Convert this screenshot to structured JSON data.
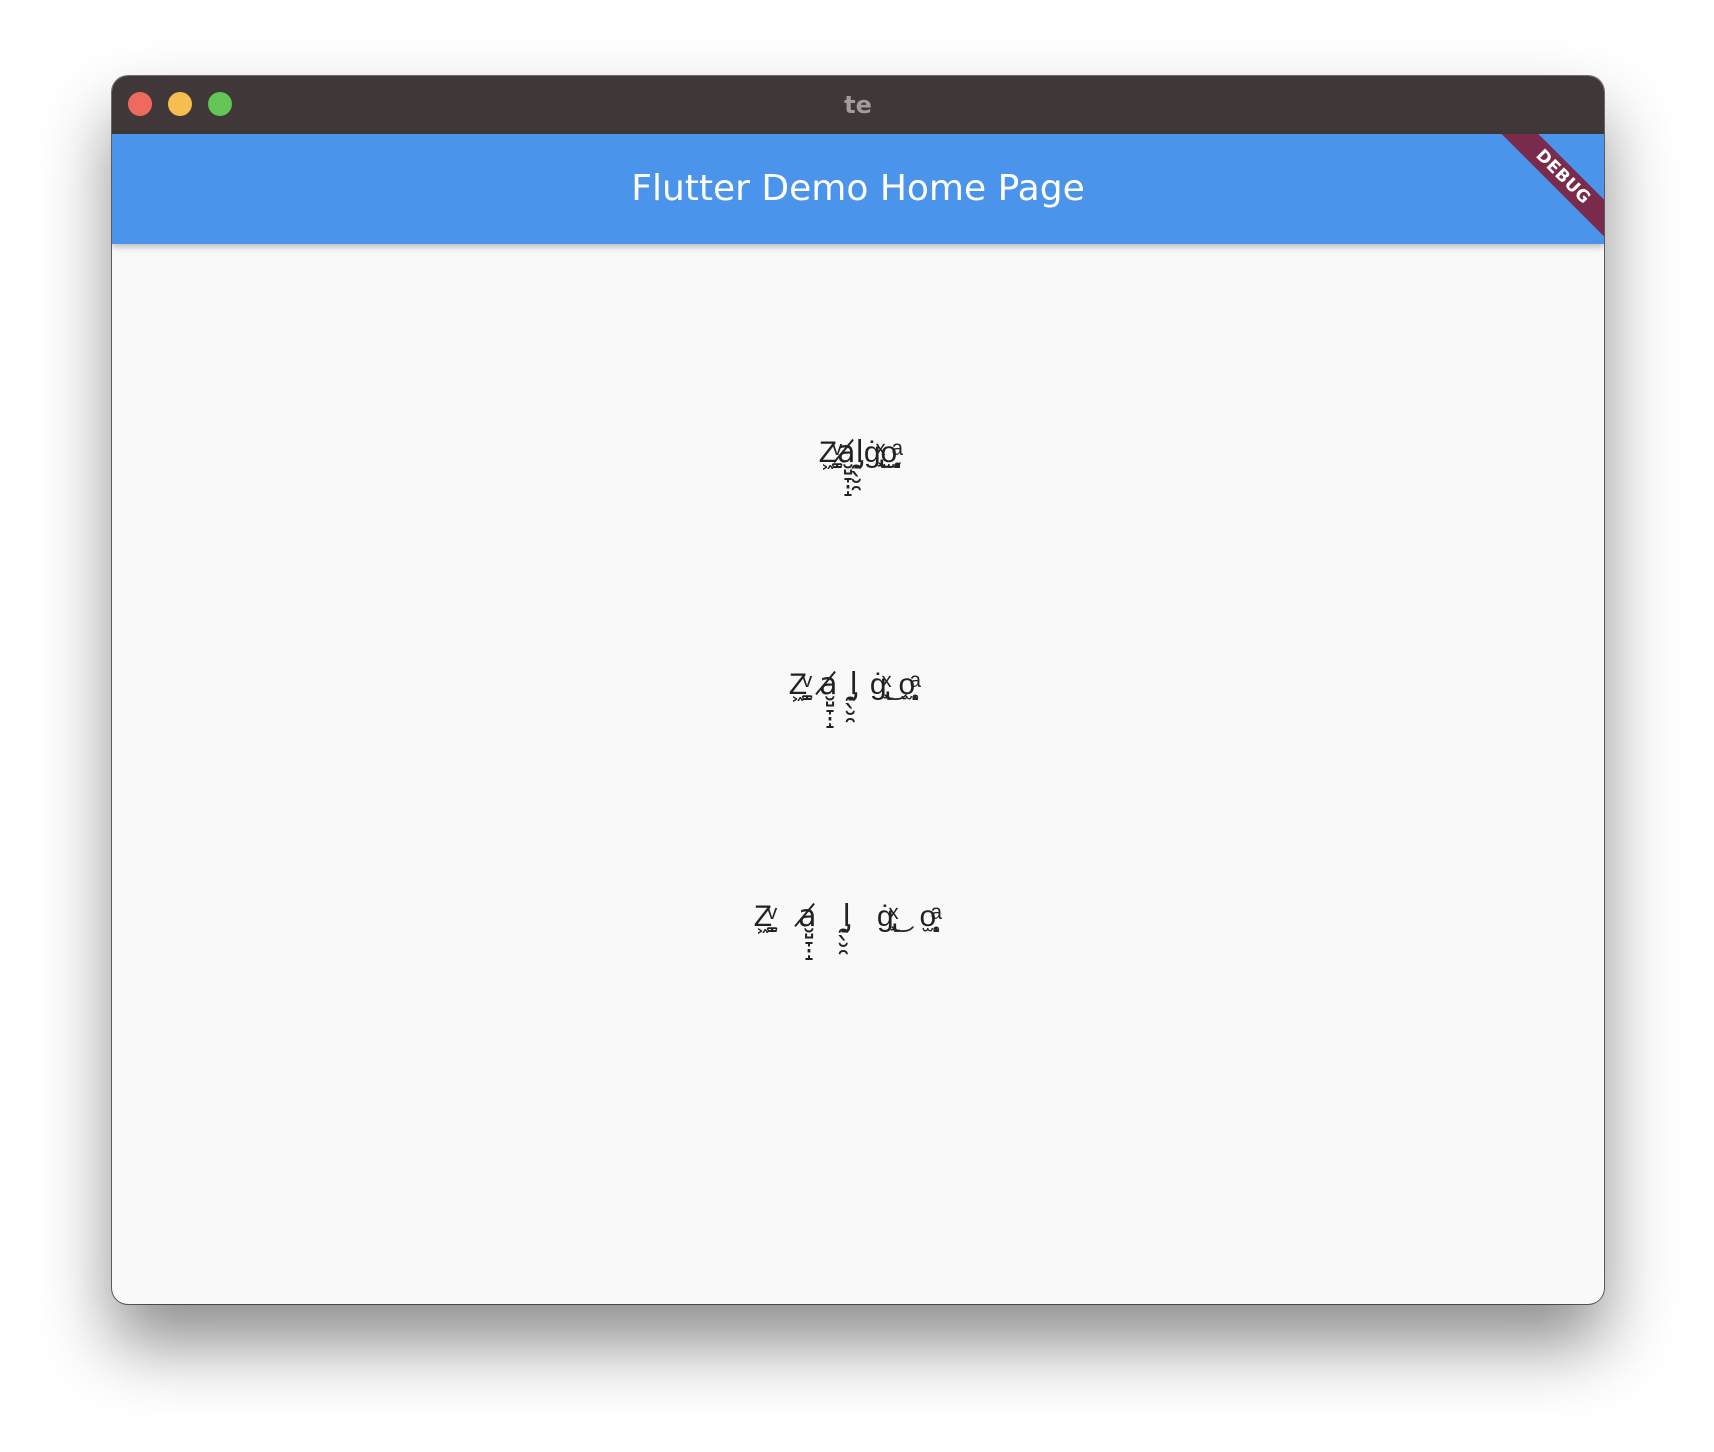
{
  "window": {
    "title": "te"
  },
  "appbar": {
    "title": "Flutter Demo Home Page"
  },
  "debug_banner": {
    "label": "DEBUG"
  },
  "texts": [
    {
      "value": "Z͖̳̫ͮͅa̸̮̺̞̣̝l̡̯̖̮̯ġ̢̘ͯ͜o̫̖̝̥ͣ"
    },
    {
      "value": "Z͖̳̫ͮͅa̸̮̺̞̣̝l̡̯̖̮̯ġ̢̘ͯ͜o̫̖̝̥ͣ"
    },
    {
      "value": "Z͖̳̫ͮͅa̸̮̺̞̣̝l̡̯̖̮̯ġ̢̘ͯ͜o̫̖̝̥ͣ"
    }
  ],
  "colors": {
    "titlebar": "#403838",
    "appbar": "#4a94eb",
    "debug_ribbon": "#7a2b4b",
    "background": "#f9f9f9"
  }
}
